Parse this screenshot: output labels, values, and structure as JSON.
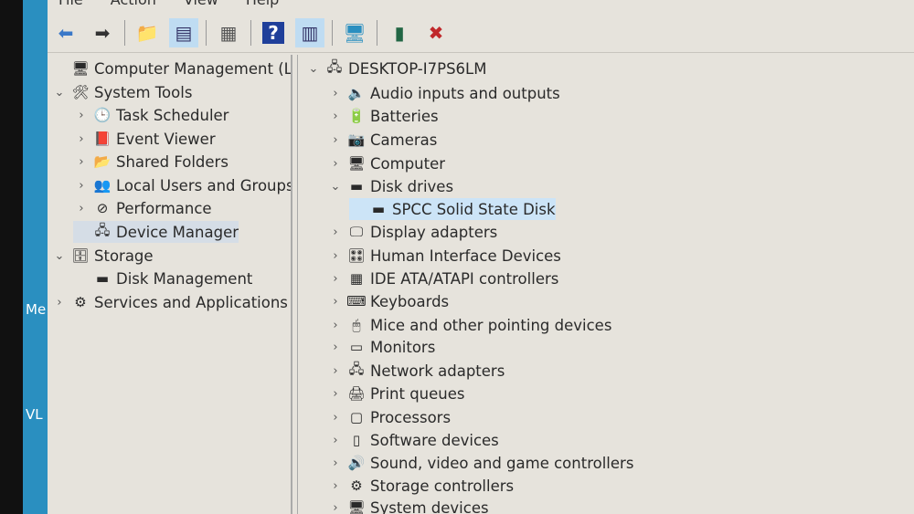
{
  "desktop": {
    "labels": [
      "Me",
      "VL"
    ]
  },
  "menu": [
    "File",
    "Action",
    "View",
    "Help"
  ],
  "toolbar": [
    {
      "name": "back-icon",
      "g": "⬅",
      "c": "#3a78c8"
    },
    {
      "name": "forward-icon",
      "g": "➡",
      "c": "#333"
    },
    {
      "name": "up-folder-icon",
      "g": "📁",
      "c": "#a77a2a"
    },
    {
      "name": "show-hide-console-tree-icon",
      "g": "▤",
      "c": "#336",
      "on": true
    },
    {
      "name": "properties-icon",
      "g": "▦",
      "c": "#555"
    },
    {
      "name": "help-icon",
      "g": "?",
      "c": "#fff",
      "bg": "#1f3f9a"
    },
    {
      "name": "show-action-pane-icon",
      "g": "▥",
      "c": "#336",
      "on": true
    },
    {
      "name": "scan-hardware-icon",
      "g": "🖥",
      "c": "#2a8fc0"
    },
    {
      "name": "update-driver-icon",
      "g": "▮",
      "c": "#264"
    },
    {
      "name": "uninstall-icon",
      "g": "✖",
      "c": "#c0282b"
    }
  ],
  "left_tree": [
    {
      "label": "Computer Management (Local",
      "level": 0,
      "chev": "",
      "icon": "🖥"
    },
    {
      "label": "System Tools",
      "level": 0,
      "chev": "⌄",
      "icon": "🛠"
    },
    {
      "label": "Task Scheduler",
      "level": 1,
      "chev": "›",
      "icon": "🕒"
    },
    {
      "label": "Event Viewer",
      "level": 1,
      "chev": "›",
      "icon": "📕"
    },
    {
      "label": "Shared Folders",
      "level": 1,
      "chev": "›",
      "icon": "📂"
    },
    {
      "label": "Local Users and Groups",
      "level": 1,
      "chev": "›",
      "icon": "👥"
    },
    {
      "label": "Performance",
      "level": 1,
      "chev": "›",
      "icon": "⊘"
    },
    {
      "label": "Device Manager",
      "level": 1,
      "chev": "",
      "icon": "🖧",
      "selected": true
    },
    {
      "label": "Storage",
      "level": 0,
      "chev": "⌄",
      "icon": "🗄"
    },
    {
      "label": "Disk Management",
      "level": 1,
      "chev": "",
      "icon": "▬"
    },
    {
      "label": "Services and Applications",
      "level": 0,
      "chev": "›",
      "icon": "⚙"
    }
  ],
  "right_tree": [
    {
      "label": "DESKTOP-I7PS6LM",
      "level": 0,
      "chev": "⌄",
      "icon": "🖧"
    },
    {
      "label": "Audio inputs and outputs",
      "level": 1,
      "chev": "›",
      "icon": "🔈"
    },
    {
      "label": "Batteries",
      "level": 1,
      "chev": "›",
      "icon": "🔋"
    },
    {
      "label": "Cameras",
      "level": 1,
      "chev": "›",
      "icon": "📷"
    },
    {
      "label": "Computer",
      "level": 1,
      "chev": "›",
      "icon": "🖥"
    },
    {
      "label": "Disk drives",
      "level": 1,
      "chev": "⌄",
      "icon": "▬"
    },
    {
      "label": "SPCC Solid State Disk",
      "level": 2,
      "chev": "",
      "icon": "▬",
      "highlight": true
    },
    {
      "label": "Display adapters",
      "level": 1,
      "chev": "›",
      "icon": "🖵"
    },
    {
      "label": "Human Interface Devices",
      "level": 1,
      "chev": "›",
      "icon": "🎛"
    },
    {
      "label": "IDE ATA/ATAPI controllers",
      "level": 1,
      "chev": "›",
      "icon": "▦"
    },
    {
      "label": "Keyboards",
      "level": 1,
      "chev": "›",
      "icon": "⌨"
    },
    {
      "label": "Mice and other pointing devices",
      "level": 1,
      "chev": "›",
      "icon": "🖱"
    },
    {
      "label": "Monitors",
      "level": 1,
      "chev": "›",
      "icon": "▭"
    },
    {
      "label": "Network adapters",
      "level": 1,
      "chev": "›",
      "icon": "🖧"
    },
    {
      "label": "Print queues",
      "level": 1,
      "chev": "›",
      "icon": "🖨"
    },
    {
      "label": "Processors",
      "level": 1,
      "chev": "›",
      "icon": "▢"
    },
    {
      "label": "Software devices",
      "level": 1,
      "chev": "›",
      "icon": "▯"
    },
    {
      "label": "Sound, video and game controllers",
      "level": 1,
      "chev": "›",
      "icon": "🔊"
    },
    {
      "label": "Storage controllers",
      "level": 1,
      "chev": "›",
      "icon": "⚙"
    },
    {
      "label": "System devices",
      "level": 1,
      "chev": "›",
      "icon": "🖥"
    }
  ]
}
